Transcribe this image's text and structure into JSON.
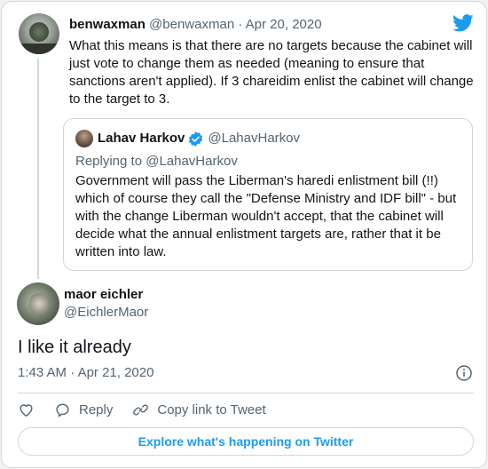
{
  "parent_tweet": {
    "name": "benwaxman",
    "handle": "@benwaxman",
    "separator": "·",
    "date": "Apr 20, 2020",
    "text": "What this means is that there are no targets because the cabinet will just vote to change them as needed (meaning to ensure that sanctions aren't applied). If 3 chareidim enlist the cabinet will change to the target to 3."
  },
  "quoted_tweet": {
    "name": "Lahav Harkov",
    "handle": "@LahavHarkov",
    "replying": "Replying to @LahavHarkov",
    "text": "Government will pass the Liberman's haredi enlistment bill (!!) which of course they call the \"Defense Ministry and IDF bill\" - but with the change Liberman wouldn't accept, that the cabinet will decide what the annual enlistment targets are, rather that it be written into law."
  },
  "main_tweet": {
    "name": "maor eichler",
    "handle": "@EichlerMaor",
    "text": "I like it already",
    "time": "1:43 AM",
    "separator": "·",
    "date": "Apr 21, 2020"
  },
  "actions": {
    "reply": "Reply",
    "copy_link": "Copy link to Tweet"
  },
  "explore_label": "Explore what's happening on Twitter",
  "icons": {
    "brand": "twitter-bird-icon",
    "verified": "verified-badge-icon",
    "info": "info-icon",
    "like": "heart-icon",
    "reply": "reply-bubble-icon",
    "link": "link-icon"
  },
  "colors": {
    "accent": "#1d9bf0",
    "muted_text": "#536471",
    "border": "#cfd9de",
    "text": "#0f1419"
  }
}
